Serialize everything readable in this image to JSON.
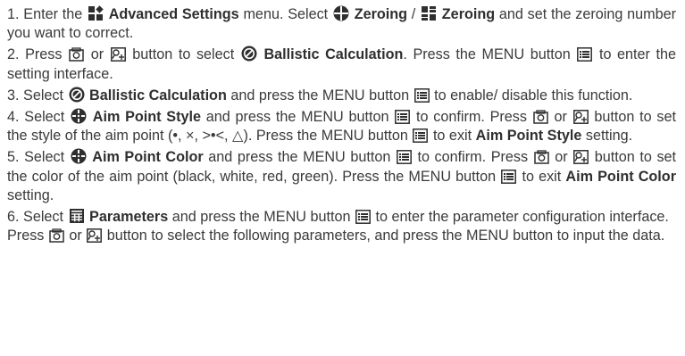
{
  "steps": [
    {
      "num": "1.",
      "t1": "Enter the",
      "b1": "Advanced Settings",
      "t2": "menu. Select",
      "b2": "Zeroing",
      "t3": "/",
      "b3": "Zeroing",
      "t4": "and set the zeroing number you want to correct.",
      "icons": [
        "advanced-settings-icon",
        "zeroing-crosshair-icon",
        "zeroing-grid-icon"
      ]
    },
    {
      "num": "2.",
      "t1": "Press",
      "t2": "or",
      "t3": "button to select",
      "b1": "Ballistic Calculation",
      "t4": ". Press the MENU button",
      "t5": "to enter the setting interface.",
      "icons": [
        "camera-button-icon",
        "zoom-button-icon",
        "ballistic-calculation-icon",
        "menu-button-icon"
      ]
    },
    {
      "num": "3.",
      "t1": "Select",
      "b1": "Ballistic Calculation",
      "t2": "and press the MENU button",
      "t3": "to enable/ disable this function.",
      "icons": [
        "ballistic-calculation-icon",
        "menu-button-icon"
      ]
    },
    {
      "num": "4.",
      "t1": "Select",
      "b1": "Aim Point Style",
      "t2": "and press the MENU button",
      "t3": "to confirm. Press",
      "t4": "or",
      "t5": "button to set the style of the aim point (",
      "shapes": "•, ×, >•<, △",
      "t6": "). Press the MENU button",
      "t7": "to exit",
      "b2": "Aim Point Style",
      "t8": "setting.",
      "icons": [
        "aim-point-icon",
        "menu-button-icon",
        "camera-button-icon",
        "zoom-button-icon"
      ]
    },
    {
      "num": "5.",
      "t1": "Select",
      "b1": "Aim Point Color",
      "t2": "and press the MENU button",
      "t3": "to confirm. Press",
      "t4": "or",
      "t5": "button to set the color of the aim point (black, white, red, green). Press the MENU button",
      "t6": "to exit",
      "b2": "Aim Point Color",
      "t7": "setting.",
      "icons": [
        "aim-point-icon",
        "menu-button-icon",
        "camera-button-icon",
        "zoom-button-icon"
      ]
    },
    {
      "num": "6.",
      "t1": "Select",
      "b1": "Parameters",
      "t2": "and press the MENU button",
      "t3": "to enter the parameter configuration interface. Press",
      "t4": "or",
      "t5": "button to select the following parameters, and press the MENU button to input the data.",
      "icons": [
        "parameters-icon",
        "menu-button-icon",
        "camera-button-icon",
        "zoom-button-icon"
      ]
    }
  ],
  "colors": {
    "text": "#3a3a3a",
    "icon": "#2f2f2f"
  }
}
